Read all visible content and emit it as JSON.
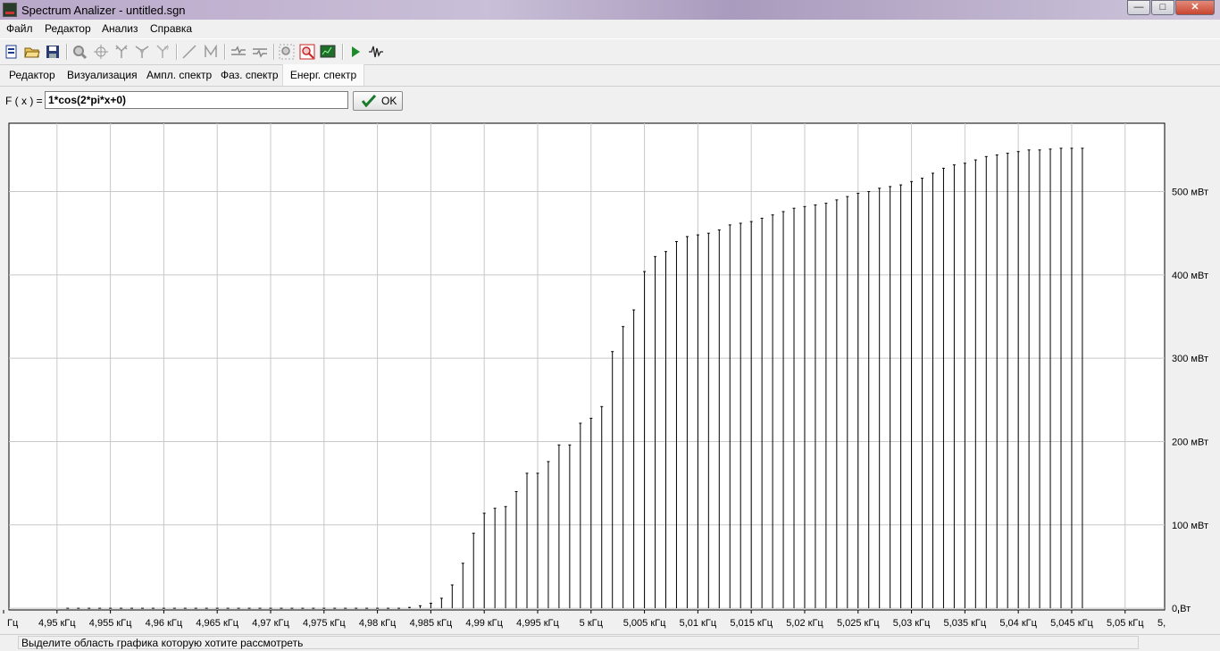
{
  "window": {
    "title": "Spectrum Analizer - untitled.sgn",
    "minimize_icon": "minimize-icon",
    "maximize_icon": "maximize-icon",
    "close_icon": "close-icon"
  },
  "menu": {
    "items": [
      {
        "label": "Файл"
      },
      {
        "label": "Редактор"
      },
      {
        "label": "Анализ"
      },
      {
        "label": "Справка"
      }
    ]
  },
  "toolbar": {
    "buttons": [
      "new-file-icon",
      "open-folder-icon",
      "save-icon",
      "zoom-icon",
      "crosshair-icon",
      "tree-icon",
      "branch-icon",
      "branch-alt-icon",
      "line-icon",
      "curve-icon",
      "filter-icon",
      "filter-alt-icon",
      "zoom-region-icon",
      "zoom-reset-icon",
      "chart-icon",
      "play-icon",
      "wave-icon"
    ]
  },
  "tabs": [
    {
      "label": "Редактор"
    },
    {
      "label": "Визуализация"
    },
    {
      "label": "Ампл. спектр"
    },
    {
      "label": "Фаз. спектр"
    },
    {
      "label": "Енерг. спектр",
      "active": true
    }
  ],
  "formula": {
    "label": "F ( x ) =",
    "value": "1*cos(2*pi*x+0)",
    "ok_label": "OK"
  },
  "status": {
    "text": "Выделите область графика которую хотите рассмотреть"
  },
  "chart_data": {
    "type": "bar",
    "x_tick_labels": [
      "Гц",
      "4,95 кГц",
      "4,955 кГц",
      "4,96 кГц",
      "4,965 кГц",
      "4,97 кГц",
      "4,975 кГц",
      "4,98 кГц",
      "4,985 кГц",
      "4,99 кГц",
      "4,995 кГц",
      "5 кГц",
      "5,005 кГц",
      "5,01 кГц",
      "5,015 кГц",
      "5,02 кГц",
      "5,025 кГц",
      "5,03 кГц",
      "5,035 кГц",
      "5,04 кГц",
      "5,045 кГц",
      "5,05 кГц",
      "5,"
    ],
    "y_tick_labels": [
      "0 Вт",
      "100 мВт",
      "200 мВт",
      "300 мВт",
      "400 мВт",
      "500 мВт"
    ],
    "y_ticks": [
      0,
      100,
      200,
      300,
      400,
      500
    ],
    "ylim": [
      -2,
      582
    ],
    "xlim": [
      4.9455,
      5.0537
    ],
    "x_unit": "кГц",
    "y_unit": "мВт",
    "grid": true,
    "x_start": 4.951,
    "x_step": 0.001,
    "values": [
      0,
      0,
      0,
      0,
      0,
      0,
      0,
      0,
      0,
      0,
      0,
      0,
      0,
      0,
      0,
      0,
      0,
      0,
      0,
      0,
      0,
      0,
      0,
      0,
      0,
      0,
      0,
      0,
      0,
      0,
      0,
      0,
      1,
      3,
      6,
      12,
      28,
      54,
      90,
      114,
      120,
      122,
      140,
      162,
      162,
      176,
      196,
      196,
      222,
      228,
      242,
      308,
      338,
      358,
      404,
      422,
      428,
      440,
      446,
      448,
      450,
      454,
      460,
      462,
      464,
      468,
      472,
      476,
      480,
      482,
      484,
      486,
      490,
      494,
      498,
      500,
      504,
      506,
      508,
      512,
      516,
      522,
      528,
      532,
      534,
      538,
      542,
      544,
      546,
      548,
      550,
      550,
      551,
      552,
      552,
      552
    ]
  }
}
